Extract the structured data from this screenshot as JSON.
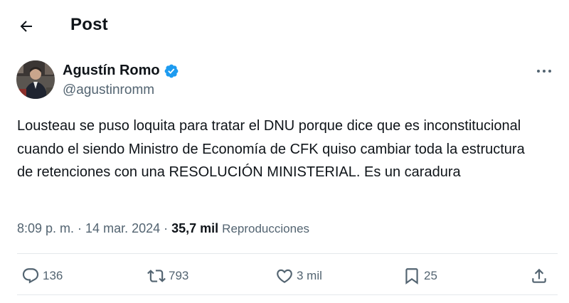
{
  "header": {
    "back_icon": "arrow-left-icon",
    "title": "Post"
  },
  "author": {
    "name": "Agustín Romo",
    "handle": "@agustinromm",
    "verified_icon": "verified-badge-icon",
    "verified_color": "#1d9bf0"
  },
  "post": {
    "text": "Lousteau se puso loquita para tratar el DNU porque dice que es inconstitucional cuando el siendo Ministro de Economía de CFK quiso cambiar toda la estructura de retenciones con una RESOLUCIÓN MINISTERIAL. Es un caradura",
    "time": "8:09 p. m.",
    "separator": " · ",
    "date": "14 mar. 2024",
    "views_count": "35,7 mil",
    "views_label": "Reproducciones"
  },
  "actions": {
    "replies": "136",
    "reposts": "793",
    "likes": "3 mil",
    "bookmarks": "25"
  },
  "colors": {
    "text": "#0f1419",
    "secondary": "#536471",
    "divider": "#e4e8eb"
  }
}
